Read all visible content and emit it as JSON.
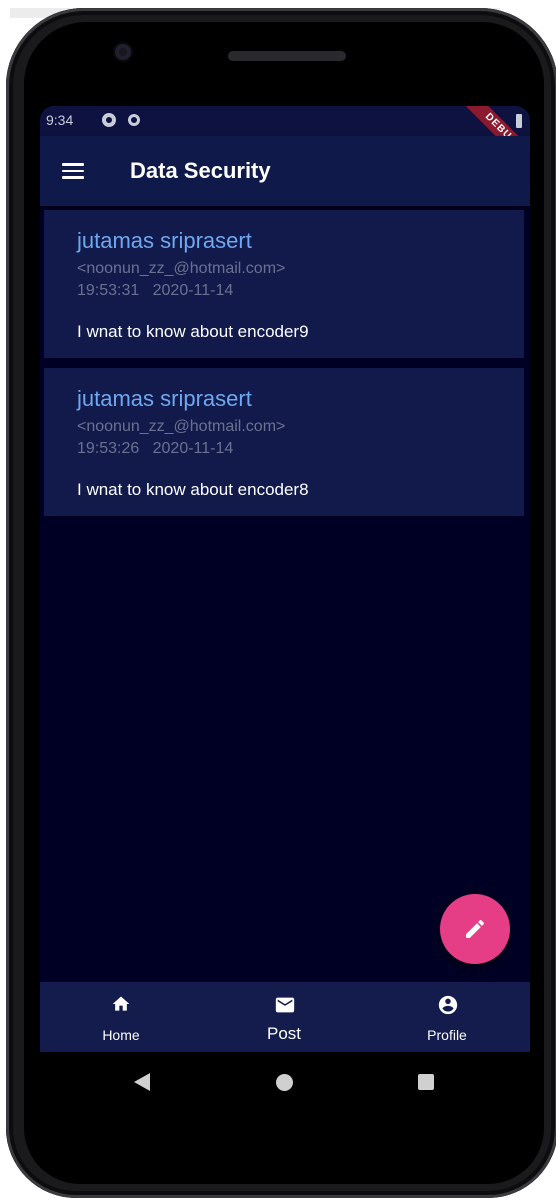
{
  "status_bar": {
    "time": "9:34"
  },
  "debug_banner": "DEBUG",
  "app_bar": {
    "title": "Data Security",
    "menu_icon": "menu-icon"
  },
  "messages": [
    {
      "name": "jutamas sriprasert",
      "email": "<noonun_zz_@hotmail.com>",
      "time": "19:53:31   2020-11-14",
      "body": "I wnat to know about encoder9"
    },
    {
      "name": "jutamas sriprasert",
      "email": "<noonun_zz_@hotmail.com>",
      "time": "19:53:26   2020-11-14",
      "body": "I wnat to know about encoder8"
    }
  ],
  "fab": {
    "icon": "edit-icon",
    "color": "#e63e86"
  },
  "bottom_nav": {
    "items": [
      {
        "label": "Home",
        "icon": "home-icon"
      },
      {
        "label": "Post",
        "icon": "mail-icon"
      },
      {
        "label": "Profile",
        "icon": "account-circle-icon"
      }
    ]
  },
  "colors": {
    "background": "#000024",
    "app_bar": "#101a4a",
    "card": "#111a4b",
    "name_text": "#6fa8f0",
    "accent": "#e63e86"
  }
}
